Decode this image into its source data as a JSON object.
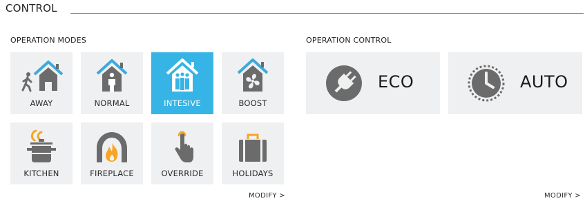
{
  "header": {
    "title": "CONTROL"
  },
  "operation_modes": {
    "label": "OPERATION MODES",
    "modify": "MODIFY >",
    "selected": "INTESIVE",
    "tiles": [
      {
        "label": "AWAY",
        "icon": "house-walking-person-icon"
      },
      {
        "label": "NORMAL",
        "icon": "house-person-icon"
      },
      {
        "label": "INTESIVE",
        "icon": "house-group-icon"
      },
      {
        "label": "BOOST",
        "icon": "house-fan-icon"
      },
      {
        "label": "KITCHEN",
        "icon": "cooking-pot-icon"
      },
      {
        "label": "FIREPLACE",
        "icon": "fireplace-icon"
      },
      {
        "label": "OVERRIDE",
        "icon": "touch-finger-icon"
      },
      {
        "label": "HOLIDAYS",
        "icon": "suitcase-icon"
      }
    ]
  },
  "operation_control": {
    "label": "OPERATION CONTROL",
    "modify": "MODIFY >",
    "buttons": [
      {
        "label": "ECO",
        "icon": "plug-icon"
      },
      {
        "label": "AUTO",
        "icon": "clock-icon"
      }
    ]
  },
  "colors": {
    "accent": "#36b4e5",
    "roof": "#3da9dc",
    "icon_gray": "#6b6b6b",
    "flame": "#f5a623",
    "tile_bg": "#eff0f1"
  }
}
